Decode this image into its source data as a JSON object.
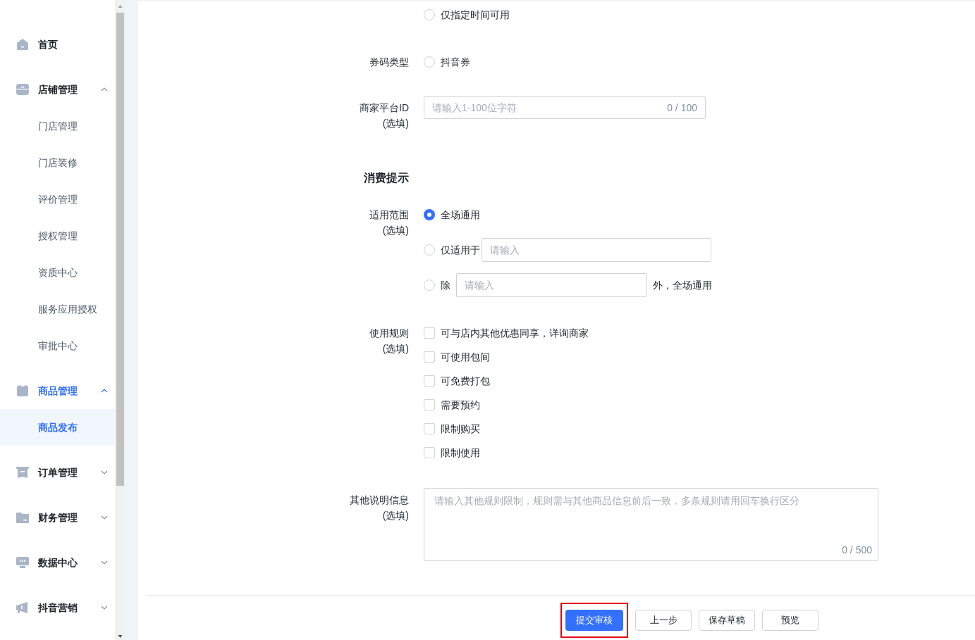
{
  "sidebar": {
    "items": [
      {
        "label": "首页",
        "active": false
      },
      {
        "label": "店铺管理",
        "active": false,
        "expanded": true,
        "children": [
          {
            "label": "门店管理",
            "selected": false
          },
          {
            "label": "门店装修",
            "selected": false
          },
          {
            "label": "评价管理",
            "selected": false
          },
          {
            "label": "授权管理",
            "selected": false
          },
          {
            "label": "资质中心",
            "selected": false
          },
          {
            "label": "服务应用授权",
            "selected": false
          },
          {
            "label": "审批中心",
            "selected": false
          }
        ]
      },
      {
        "label": "商品管理",
        "active": true,
        "expanded": true,
        "children": [
          {
            "label": "商品发布",
            "selected": true
          }
        ]
      },
      {
        "label": "订单管理",
        "active": false,
        "expanded": false
      },
      {
        "label": "财务管理",
        "active": false,
        "expanded": false
      },
      {
        "label": "数据中心",
        "active": false,
        "expanded": false
      },
      {
        "label": "抖音营销",
        "active": false,
        "expanded": false
      }
    ]
  },
  "form": {
    "time_option": {
      "label": "仅指定时间可用",
      "selected": false
    },
    "code_type": {
      "label": "券码类型",
      "options": [
        {
          "label": "抖音券",
          "selected": false
        }
      ]
    },
    "merchant_id": {
      "label": "商家平台ID",
      "optional": "(选填)",
      "placeholder": "请输入1-100位字符",
      "counter": "0 / 100"
    },
    "section_title": "消费提示",
    "scope": {
      "label": "适用范围",
      "optional": "(选填)",
      "options": [
        {
          "kind": "text",
          "label": "全场通用",
          "selected": true
        },
        {
          "kind": "input",
          "label": "仅适用于",
          "placeholder": "请输入",
          "selected": false
        },
        {
          "kind": "between",
          "label": "除",
          "placeholder": "请输入",
          "suffix": "外，全场通用",
          "selected": false
        }
      ]
    },
    "rules": {
      "label": "使用规则",
      "optional": "(选填)",
      "options": [
        {
          "label": "可与店内其他优惠同享，详询商家",
          "checked": false
        },
        {
          "label": "可使用包间",
          "checked": false
        },
        {
          "label": "可免费打包",
          "checked": false
        },
        {
          "label": "需要预约",
          "checked": false
        },
        {
          "label": "限制购买",
          "checked": false
        },
        {
          "label": "限制使用",
          "checked": false
        }
      ]
    },
    "other_info": {
      "label": "其他说明信息",
      "optional": "(选填)",
      "placeholder": "请输入其他规则限制，规则需与其他商品信息前后一致，多条规则请用回车换行区分",
      "counter": "0 / 500"
    }
  },
  "footer": {
    "buttons": [
      {
        "label": "提交审核",
        "kind": "primary",
        "highlighted": true
      },
      {
        "label": "上一步",
        "kind": "default",
        "highlighted": false
      },
      {
        "label": "保存草稿",
        "kind": "default",
        "highlighted": false
      },
      {
        "label": "预览",
        "kind": "default",
        "highlighted": false
      }
    ]
  }
}
